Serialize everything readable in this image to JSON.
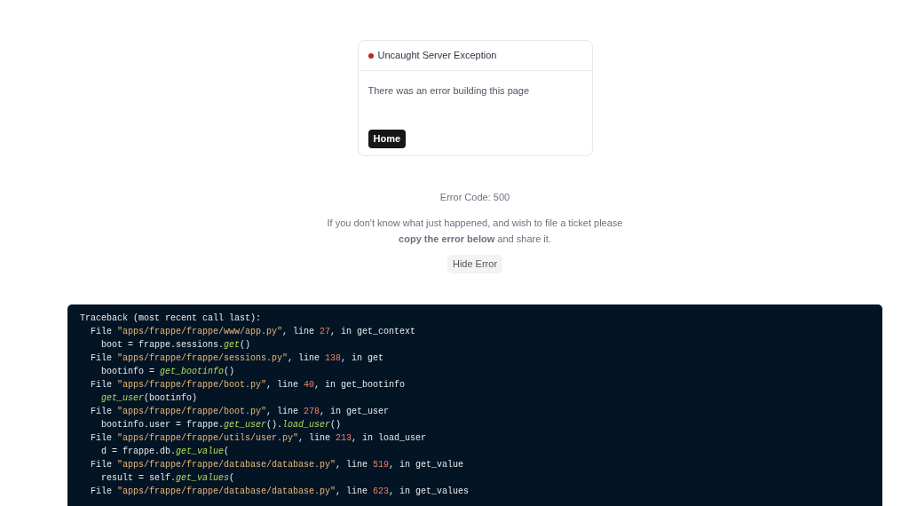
{
  "card": {
    "title": "Uncaught Server Exception",
    "message": "There was an error building this page",
    "button": "Home"
  },
  "error_code": "Error Code: 500",
  "help_text": "If you don't know what just happened, and wish to file a ticket please **copy the error below** and share it.",
  "toggle_button": "Hide Error",
  "traceback": [
    {
      "kind": "header",
      "tokens": [
        {
          "kind": "plain",
          "text": "Traceback (most recent call last):"
        }
      ]
    },
    {
      "kind": "frame",
      "tokens": [
        {
          "kind": "plain",
          "text": "File "
        },
        {
          "kind": "string",
          "text": "\"apps/frappe/frappe/www/app.py\""
        },
        {
          "kind": "plain",
          "text": ", line "
        },
        {
          "kind": "number",
          "text": "27"
        },
        {
          "kind": "plain",
          "text": ", in get_context"
        }
      ]
    },
    {
      "kind": "source",
      "tokens": [
        {
          "kind": "plain",
          "text": "boot = frappe.sessions."
        },
        {
          "kind": "func",
          "text": "get"
        },
        {
          "kind": "plain",
          "text": "()"
        }
      ]
    },
    {
      "kind": "frame",
      "tokens": [
        {
          "kind": "plain",
          "text": "File "
        },
        {
          "kind": "string",
          "text": "\"apps/frappe/frappe/sessions.py\""
        },
        {
          "kind": "plain",
          "text": ", line "
        },
        {
          "kind": "number",
          "text": "138"
        },
        {
          "kind": "plain",
          "text": ", in get"
        }
      ]
    },
    {
      "kind": "source",
      "tokens": [
        {
          "kind": "plain",
          "text": "bootinfo = "
        },
        {
          "kind": "func",
          "text": "get_bootinfo"
        },
        {
          "kind": "plain",
          "text": "()"
        }
      ]
    },
    {
      "kind": "frame",
      "tokens": [
        {
          "kind": "plain",
          "text": "File "
        },
        {
          "kind": "string",
          "text": "\"apps/frappe/frappe/boot.py\""
        },
        {
          "kind": "plain",
          "text": ", line "
        },
        {
          "kind": "number",
          "text": "40"
        },
        {
          "kind": "plain",
          "text": ", in get_bootinfo"
        }
      ]
    },
    {
      "kind": "source",
      "tokens": [
        {
          "kind": "func",
          "text": "get_user"
        },
        {
          "kind": "plain",
          "text": "(bootinfo)"
        }
      ]
    },
    {
      "kind": "frame",
      "tokens": [
        {
          "kind": "plain",
          "text": "File "
        },
        {
          "kind": "string",
          "text": "\"apps/frappe/frappe/boot.py\""
        },
        {
          "kind": "plain",
          "text": ", line "
        },
        {
          "kind": "number",
          "text": "278"
        },
        {
          "kind": "plain",
          "text": ", in get_user"
        }
      ]
    },
    {
      "kind": "source",
      "tokens": [
        {
          "kind": "plain",
          "text": "bootinfo.user = frappe."
        },
        {
          "kind": "func",
          "text": "get_user"
        },
        {
          "kind": "plain",
          "text": "()."
        },
        {
          "kind": "func",
          "text": "load_user"
        },
        {
          "kind": "plain",
          "text": "()"
        }
      ]
    },
    {
      "kind": "frame",
      "tokens": [
        {
          "kind": "plain",
          "text": "File "
        },
        {
          "kind": "string",
          "text": "\"apps/frappe/frappe/utils/user.py\""
        },
        {
          "kind": "plain",
          "text": ", line "
        },
        {
          "kind": "number",
          "text": "213"
        },
        {
          "kind": "plain",
          "text": ", in load_user"
        }
      ]
    },
    {
      "kind": "source",
      "tokens": [
        {
          "kind": "plain",
          "text": "d = frappe.db."
        },
        {
          "kind": "func",
          "text": "get_value"
        },
        {
          "kind": "plain",
          "text": "("
        }
      ]
    },
    {
      "kind": "frame",
      "tokens": [
        {
          "kind": "plain",
          "text": "File "
        },
        {
          "kind": "string",
          "text": "\"apps/frappe/frappe/database/database.py\""
        },
        {
          "kind": "plain",
          "text": ", line "
        },
        {
          "kind": "number",
          "text": "519"
        },
        {
          "kind": "plain",
          "text": ", in get_value"
        }
      ]
    },
    {
      "kind": "source",
      "tokens": [
        {
          "kind": "plain",
          "text": "result = self."
        },
        {
          "kind": "func",
          "text": "get_values"
        },
        {
          "kind": "plain",
          "text": "("
        }
      ]
    },
    {
      "kind": "frame",
      "tokens": [
        {
          "kind": "plain",
          "text": "File "
        },
        {
          "kind": "string",
          "text": "\"apps/frappe/frappe/database/database.py\""
        },
        {
          "kind": "plain",
          "text": ", line "
        },
        {
          "kind": "number",
          "text": "623"
        },
        {
          "kind": "plain",
          "text": ", in get_values"
        }
      ]
    }
  ]
}
